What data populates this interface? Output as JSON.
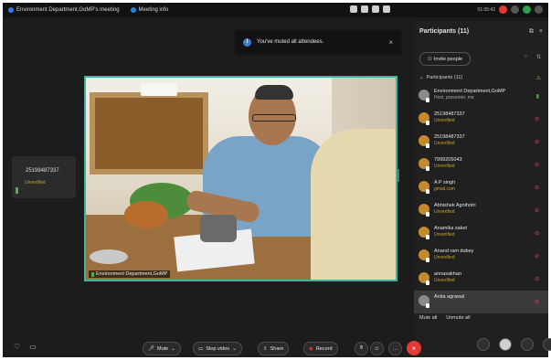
{
  "titlebar": {
    "tab1": "Environment Department,GoMP's meeting",
    "tab2": "Meeting info",
    "time": "01:05:42"
  },
  "toast": {
    "message": "You've muted all attendees."
  },
  "thumbnail": {
    "name": "25198487337",
    "status": "Unverified"
  },
  "video": {
    "label": "Environment Department,GoMP"
  },
  "panel": {
    "title": "Participants (11)",
    "invite_label": "Invite people",
    "section_label": "Participants (11)",
    "participants": [
      {
        "name": "Environment Department,GoMP",
        "sub": "Host, presenter, me",
        "state": "on"
      },
      {
        "name": "25198487337",
        "sub": "Unverified",
        "state": "muted"
      },
      {
        "name": "25198487337",
        "sub": "Unverified",
        "state": "muted"
      },
      {
        "name": "7999205043",
        "sub": "Unverified",
        "state": "muted"
      },
      {
        "name": "A P singh",
        "sub": "gmail.com",
        "state": "muted"
      },
      {
        "name": "Abhishek Agnihotri",
        "sub": "Unverified",
        "state": "muted"
      },
      {
        "name": "Anamika saket",
        "sub": "Unverified",
        "state": "muted"
      },
      {
        "name": "Anand ram dubey",
        "sub": "Unverified",
        "state": "muted"
      },
      {
        "name": "annasakhan",
        "sub": "Unverified",
        "state": "muted"
      },
      {
        "name": "Anita agrawal",
        "sub": "",
        "state": "muted"
      }
    ],
    "mute_all": "Mute all",
    "unmute_all": "Unmute all"
  },
  "controls": {
    "mute": "Mute",
    "stop_video": "Stop video",
    "share": "Share",
    "record": "Record"
  },
  "colors": {
    "accent": "#3db3a3",
    "end": "#e53935",
    "muted": "#e04646",
    "unverified": "#c9a227"
  }
}
